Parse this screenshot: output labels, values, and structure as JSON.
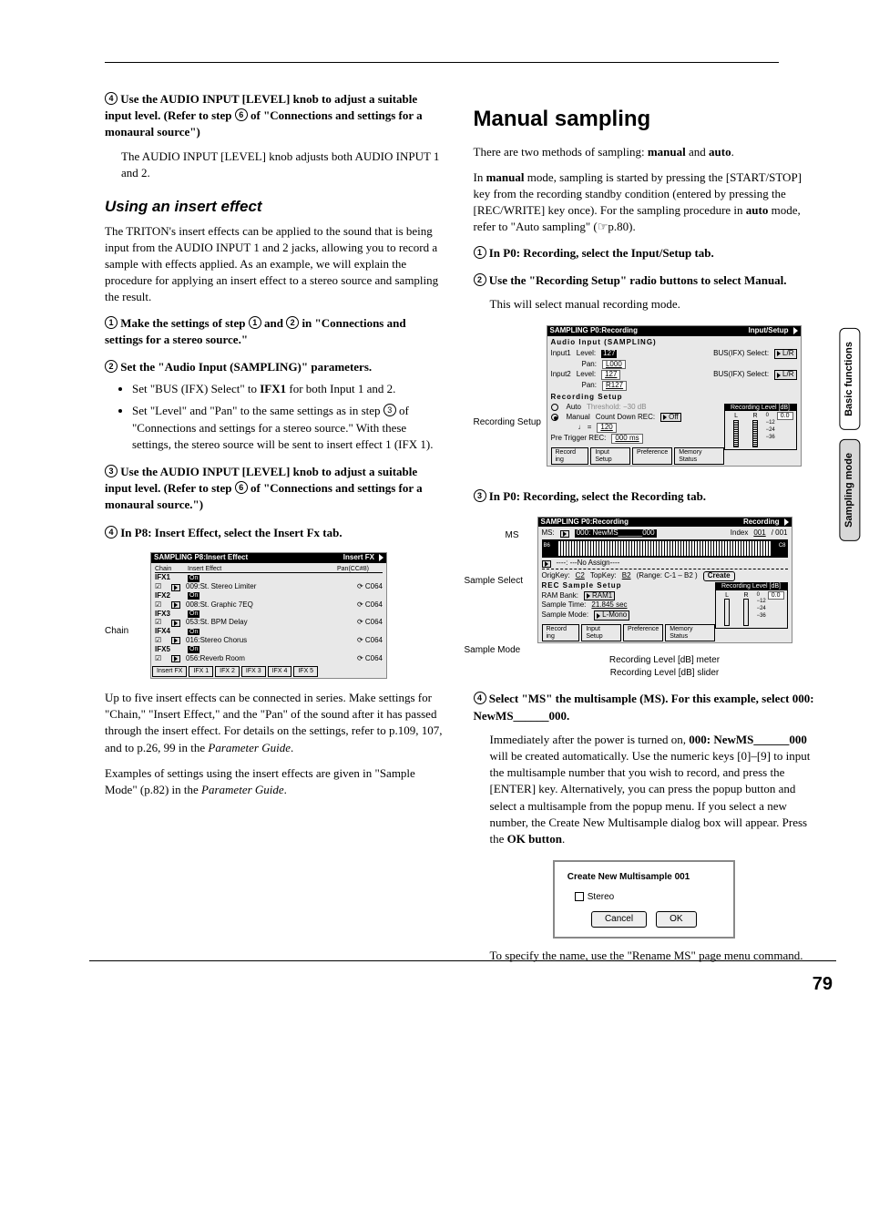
{
  "pagenum": "79",
  "side_tabs": [
    "Basic functions",
    "Sampling mode"
  ],
  "left": {
    "step4": {
      "num": "4",
      "bold": "Use the AUDIO INPUT [LEVEL] knob to adjust a suitable input level. (Refer to step ",
      "bold_inline_num": "6",
      "bold_tail": " of \"Connections and settings for a monaural source\")",
      "body": "The AUDIO INPUT [LEVEL] knob adjusts both AUDIO INPUT 1 and 2."
    },
    "h3_insert": "Using an insert effect",
    "insert_intro": "The TRITON's insert effects can be applied to the sound that is being input from the AUDIO INPUT 1 and 2 jacks, allowing you to record a sample with effects applied. As an example, we will explain the procedure for applying an insert effect to a stereo source and sampling the result.",
    "ins_step1": {
      "num": "1",
      "bold_a": "Make the settings of step ",
      "ref1": "1",
      "bold_b": " and ",
      "ref2": "2",
      "bold_c": " in \"Connections and settings for a stereo source.\""
    },
    "ins_step2": {
      "num": "2",
      "bold": "Set the \"Audio Input (SAMPLING)\" parameters.",
      "bullet1_a": "Set \"BUS (IFX) Select\" to ",
      "bullet1_bold": "IFX1",
      "bullet1_b": " for both Input 1 and 2.",
      "bullet2": "Set \"Level\" and \"Pan\" to the same settings as in step ",
      "bullet2_num": "3",
      "bullet2_tail": " of \"Connections and settings for a stereo source.\" With these settings, the stereo source will be sent to insert effect 1 (IFX 1)."
    },
    "ins_step3": {
      "num": "3",
      "bold": "Use the AUDIO INPUT [LEVEL] knob to adjust a suitable input level. (Refer to step ",
      "bold_inline_num": "6",
      "bold_tail": " of \"Connections and settings for a monaural source.\")"
    },
    "ins_step4": {
      "num": "4",
      "bold": "In P8: Insert Effect, select the Insert Fx tab."
    },
    "fig1_label": "Chain",
    "lcd1": {
      "title_left": "SAMPLING P8:Insert Effect",
      "title_right": "Insert FX",
      "cols": [
        "Chain",
        "Insert Effect",
        "Pan(CC#8)"
      ],
      "rows": [
        {
          "name": "IFX1",
          "on": "On",
          "fx": "009:St. Stereo Limiter",
          "pan": "C064"
        },
        {
          "name": "IFX2",
          "on": "On",
          "fx": "008:St. Graphic 7EQ",
          "pan": "C064"
        },
        {
          "name": "IFX3",
          "on": "On",
          "fx": "053:St. BPM Delay",
          "pan": "C064"
        },
        {
          "name": "IFX4",
          "on": "On",
          "fx": "016:Stereo Chorus",
          "pan": "C064"
        },
        {
          "name": "IFX5",
          "on": "On",
          "fx": "056:Reverb Room",
          "pan": "C064"
        }
      ],
      "tabs": [
        "Insert FX",
        "IFX 1",
        "IFX 2",
        "IFX 3",
        "IFX 4",
        "IFX 5"
      ]
    },
    "after_fig1_p1": "Up to five insert effects can be connected in series. Make settings for \"Chain,\" \"Insert Effect,\" and the \"Pan\" of the sound after it has passed through the insert effect. For details on the settings, refer to p.109, 107, and to p.26, 99 in the ",
    "after_fig1_p1_i": "Parameter Guide",
    "after_fig1_p1_end": ".",
    "after_fig1_p2": "Examples of settings using the insert effects are given in \"Sample Mode\" (p.82) in the ",
    "after_fig1_p2_i": "Parameter Guide",
    "after_fig1_p2_end": "."
  },
  "right": {
    "h2": "Manual sampling",
    "intro_a": "There are two methods of sampling: ",
    "intro_b1": "manual",
    "intro_mid": " and ",
    "intro_b2": "auto",
    "intro_end": ".",
    "para2_a": "In ",
    "para2_b": "manual",
    "para2_c": " mode, sampling is started by pressing the [START/STOP] key from the recording standby condition (entered by pressing the [REC/WRITE] key once). For the sampling procedure in ",
    "para2_d": "auto",
    "para2_e": " mode, refer to \"Auto sampling\" (☞p.80).",
    "step1": {
      "num": "1",
      "bold": "In P0: Recording, select the Input/Setup tab."
    },
    "step2": {
      "num": "2",
      "bold": "Use the \"Recording Setup\" radio buttons to select Manual.",
      "body": "This will select manual recording mode."
    },
    "fig2_label": "Recording Setup",
    "lcd2": {
      "title_left": "SAMPLING P0:Recording",
      "title_right": "Input/Setup",
      "sec1": "Audio Input (SAMPLING)",
      "in1": {
        "label": "Input1",
        "lvl_l": "Level:",
        "lvl_v": "127",
        "pan_l": "Pan:",
        "pan_v": "L000",
        "bus_l": "BUS(IFX) Select:",
        "bus_v": "L/R"
      },
      "in2": {
        "label": "Input2",
        "lvl_l": "Level:",
        "lvl_v": "127",
        "pan_l": "Pan:",
        "pan_v": "R127",
        "bus_l": "BUS(IFX) Select:",
        "bus_v": "L/R"
      },
      "sec2": "Recording Setup",
      "auto": "Auto",
      "auto_thresh": "Threshold: −30 dB",
      "manual": "Manual",
      "cdrec": "Count Down REC:",
      "cdrec_v": "Off",
      "tempo": "♩ = ",
      "tempo_v": "120",
      "pretrig": "Pre Trigger REC:",
      "pretrig_v": "000 ms",
      "meter_title": "Recording Level [dB]",
      "meter_marks": [
        "L",
        "R",
        "0",
        "−12",
        "−24",
        "−36"
      ],
      "meter_val": "0.0",
      "tabs": [
        "Record ing",
        "Input Setup",
        "Preference",
        "Memory Status"
      ]
    },
    "step3": {
      "num": "3",
      "bold": "In P0: Recording, select the Recording tab."
    },
    "fig3_labels": {
      "ms": "MS",
      "sample_select": "Sample Select",
      "sample_mode": "Sample Mode",
      "cap1": "Recording Level [dB] meter",
      "cap2": "Recording Level [dB] slider"
    },
    "lcd3": {
      "title_left": "SAMPLING P0:Recording",
      "title_right": "Recording",
      "ms_l": "MS:",
      "ms_v": "000: NewMS______000",
      "idx_l": "Index",
      "idx_v": "001",
      "idx_tot": "/ 001",
      "kbd_left": "B6",
      "kbd_right": "C8",
      "sel_v": "----:  ---No Assign----",
      "orig": "OrigKey:",
      "orig_v": "C2",
      "top": "TopKey:",
      "top_v": "B2",
      "range": "(Range: C-1 – B2   )",
      "create": "Create",
      "sec": "REC Sample Setup",
      "meter_title": "Recording Level [dB]",
      "ram": "RAM Bank:",
      "ram_v": "RAM1",
      "st": "Sample Time:",
      "st_v": "21.845 sec",
      "sm": "Sample Mode:",
      "sm_v": "L-Mono",
      "meter_marks": [
        "L",
        "R",
        "0",
        "−12",
        "−24",
        "−36"
      ],
      "meter_val": "0.0",
      "tabs": [
        "Record ing",
        "Input Setup",
        "Preference",
        "Memory Status"
      ]
    },
    "step4": {
      "num": "4",
      "bold": "Select \"MS\" the multisample (MS). For this example, select 000: NewMS______000.",
      "body_a": "Immediately after the power is turned on, ",
      "body_bold": "000: NewMS______000",
      "body_b": " will be created automatically. Use the numeric keys [0]–[9] to input the multisample number that you wish to record, and press the [ENTER] key. Alternatively, you can press the popup button and select a multisample from the popup menu. If you select a new number, the Create New Multisample dialog box will appear. Press the ",
      "body_bold2": "OK button",
      "body_c": "."
    },
    "dialog": {
      "title": "Create New Multisample 001",
      "chk": "Stereo",
      "cancel": "Cancel",
      "ok": "OK"
    },
    "tail": "To specify the name, use the \"Rename MS\" page menu command."
  }
}
